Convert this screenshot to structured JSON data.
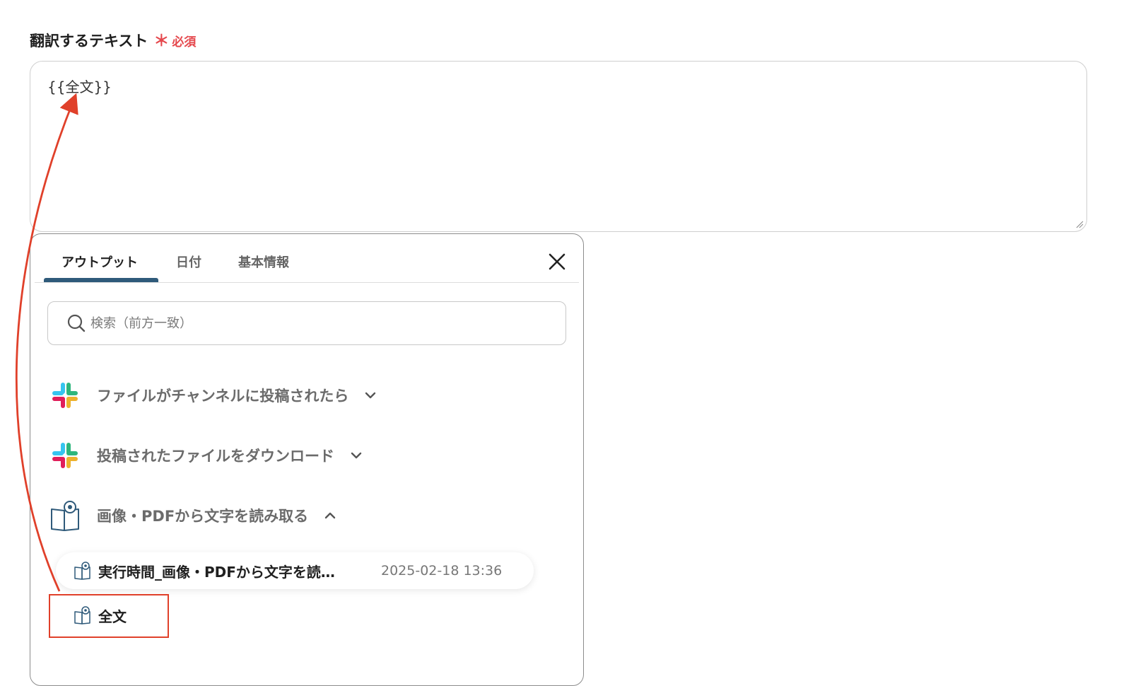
{
  "field": {
    "label": "翻訳するテキスト",
    "required_mark": "＊",
    "required_text": "必須",
    "value": "{{全文}}"
  },
  "panel": {
    "tabs": [
      {
        "label": "アウトプット",
        "active": true
      },
      {
        "label": "日付",
        "active": false
      },
      {
        "label": "基本情報",
        "active": false
      }
    ],
    "search_placeholder": "検索（前方一致）",
    "groups": [
      {
        "label": "ファイルがチャンネルに投稿されたら",
        "icon": "slack-icon",
        "expanded": false
      },
      {
        "label": "投稿されたファイルをダウンロード",
        "icon": "slack-icon",
        "expanded": false
      },
      {
        "label": "画像・PDFから文字を読み取る",
        "icon": "ocr-book-icon",
        "expanded": true
      }
    ],
    "items": [
      {
        "label": "実行時間_画像・PDFから文字を読…",
        "date": "2025-02-18 13:36"
      },
      {
        "label": "全文"
      }
    ]
  },
  "colors": {
    "accent": "#2f5a7a",
    "required": "#e5484d",
    "highlight": "#e0402a"
  }
}
